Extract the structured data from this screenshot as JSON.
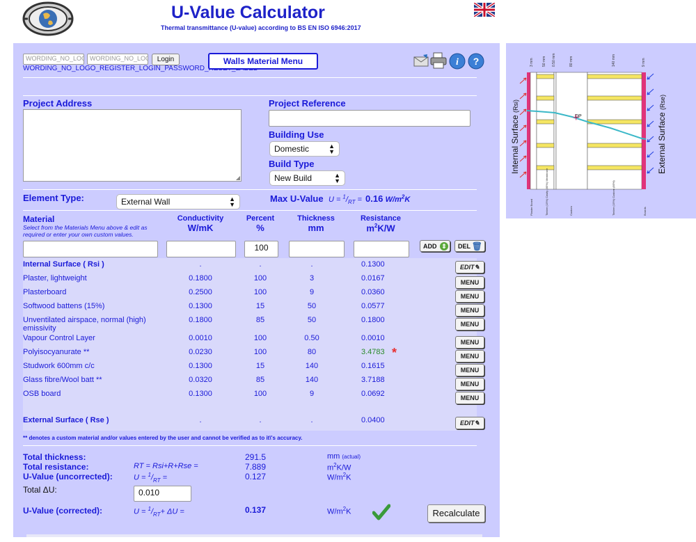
{
  "header": {
    "title": "U-Value Calculator",
    "subtitle": "Thermal transmittance (U-value) according to BS EN ISO 6946:2017"
  },
  "login": {
    "field1": "WORDING_NO_LOGO",
    "field2": "WORDING_NO_LOGO",
    "button": "Login",
    "links": "WORDING_NO_LOGO_REGISTER_LOGIN_PASSWORD_RESET_LABEL"
  },
  "toolbar": {
    "materials_menu": "Walls Material Menu",
    "icons": [
      "email-icon",
      "print-icon",
      "info-icon",
      "help-icon"
    ]
  },
  "project": {
    "address_label": "Project Address",
    "reference_label": "Project Reference",
    "building_use_label": "Building Use",
    "building_use": "Domestic",
    "build_type_label": "Build Type",
    "build_type": "New Build"
  },
  "element": {
    "label": "Element Type:",
    "value": "External Wall",
    "max_label": "Max U-Value",
    "formula_prefix": "U = ",
    "formula_sup": "1",
    "formula_slash": "/",
    "formula_sub": "RT",
    "formula_eq": " = ",
    "max_value": "0.16",
    "max_unit_base": "W/m",
    "max_unit_sup": "2",
    "max_unit_end": "K"
  },
  "table": {
    "headers": {
      "material": "Material",
      "material_hint": "Select from the Materials Menu above & edit as required or enter your own custom values.",
      "conductivity": "Conductivity",
      "conductivity_unit": "W/mK",
      "percent": "Percent",
      "percent_unit": "%",
      "thickness": "Thickness",
      "thickness_unit": "mm",
      "resistance": "Resistance",
      "resistance_unit_base": "m",
      "resistance_unit_sup": "2",
      "resistance_unit_end": "K/W"
    },
    "entry_percent": "100",
    "add_label": "ADD",
    "del_label": "DEL",
    "rows": [
      {
        "material": "Internal Surface ( Rsi )",
        "conductivity": ".",
        "percent": ".",
        "thickness": ".",
        "resistance": "0.1300",
        "button": "EDIT",
        "bold": true
      },
      {
        "material": "Plaster, lightweight",
        "conductivity": "0.1800",
        "percent": "100",
        "thickness": "3",
        "resistance": "0.0167",
        "button": "MENU"
      },
      {
        "material": "Plasterboard",
        "conductivity": "0.2500",
        "percent": "100",
        "thickness": "9",
        "resistance": "0.0360",
        "button": "MENU"
      },
      {
        "material": "Softwood battens (15%)",
        "conductivity": "0.1300",
        "percent": "15",
        "thickness": "50",
        "resistance": "0.0577",
        "button": "MENU"
      },
      {
        "material": "Unventilated airspace, normal (high) emissivity",
        "conductivity": "0.1800",
        "percent": "85",
        "thickness": "50",
        "resistance": "0.1800",
        "button": "MENU"
      },
      {
        "material": "Vapour Control Layer",
        "conductivity": "0.0010",
        "percent": "100",
        "thickness": "0.50",
        "resistance": "0.0010",
        "button": "MENU"
      },
      {
        "material": "Polyisocyanurate **",
        "conductivity": "0.0230",
        "percent": "100",
        "thickness": "80",
        "resistance": "3.4783",
        "button": "MENU",
        "highlight": true
      },
      {
        "material": "Studwork 600mm c/c",
        "conductivity": "0.1300",
        "percent": "15",
        "thickness": "140",
        "resistance": "0.1615",
        "button": "MENU"
      },
      {
        "material": "Glass fibre/Wool batt **",
        "conductivity": "0.0320",
        "percent": "85",
        "thickness": "140",
        "resistance": "3.7188",
        "button": "MENU"
      },
      {
        "material": "OSB board",
        "conductivity": "0.1300",
        "percent": "100",
        "thickness": "9",
        "resistance": "0.0692",
        "button": "MENU"
      },
      {
        "material": "External Surface ( Rse )",
        "conductivity": ".",
        "percent": ".",
        "thickness": ".",
        "resistance": "0.0400",
        "button": "EDIT",
        "bold": true
      }
    ],
    "star": "*",
    "footnote": "** denotes a custom material and/or values entered by the user and cannot be verified as to it\\'s accuracy."
  },
  "totals": {
    "thickness_label": "Total thickness:",
    "thickness_value": "291.5",
    "thickness_unit": "mm",
    "thickness_unit_note": "(actual)",
    "resistance_label": "Total resistance:",
    "resistance_formula": "RT = Rsi+R+Rse =",
    "resistance_value": "7.889",
    "resistance_unit_base": "m",
    "resistance_unit_sup": "2",
    "resistance_unit_end": "K/W",
    "uvalue_label": "U-Value (uncorrected):",
    "uvalue_formula_prefix": "U = ",
    "uvalue_formula_sup": "1",
    "uvalue_formula_slash": "/",
    "uvalue_formula_sub": "RT",
    "uvalue_formula_eq": " =",
    "uvalue_value": "0.127",
    "uvalue_unit_base": "W/m",
    "uvalue_unit_sup": "2",
    "uvalue_unit_end": "K",
    "delta_label": "Total ΔU:",
    "delta_value": "0.010",
    "corrected_label": "U-Value (corrected):",
    "corrected_formula_prefix": "U = ",
    "corrected_formula_sup": "1",
    "corrected_formula_slash": "/",
    "corrected_formula_sub": "RT",
    "corrected_formula_end": "+ ΔU =",
    "corrected_value": "0.137",
    "corrected_unit_base": "W/m",
    "corrected_unit_sup": "2",
    "corrected_unit_end": "K",
    "recalculate": "Recalculate"
  },
  "graph": {
    "internal_label": "Internal Surface",
    "internal_sub": "(Rsi)",
    "external_label": "External Surface",
    "external_sub": "(Rse)",
    "dp_label": "DP",
    "top_labels": [
      "3 mm",
      "50 mm",
      "0.50 mm",
      "80 mm",
      "140 mm",
      "9 mm"
    ],
    "bottom_labels": [
      "Plaster Board",
      "Timber (15%) Cavity (85%) Membrane",
      "Custom",
      "Timber (15%) Custom (85%)",
      "Boards"
    ]
  }
}
